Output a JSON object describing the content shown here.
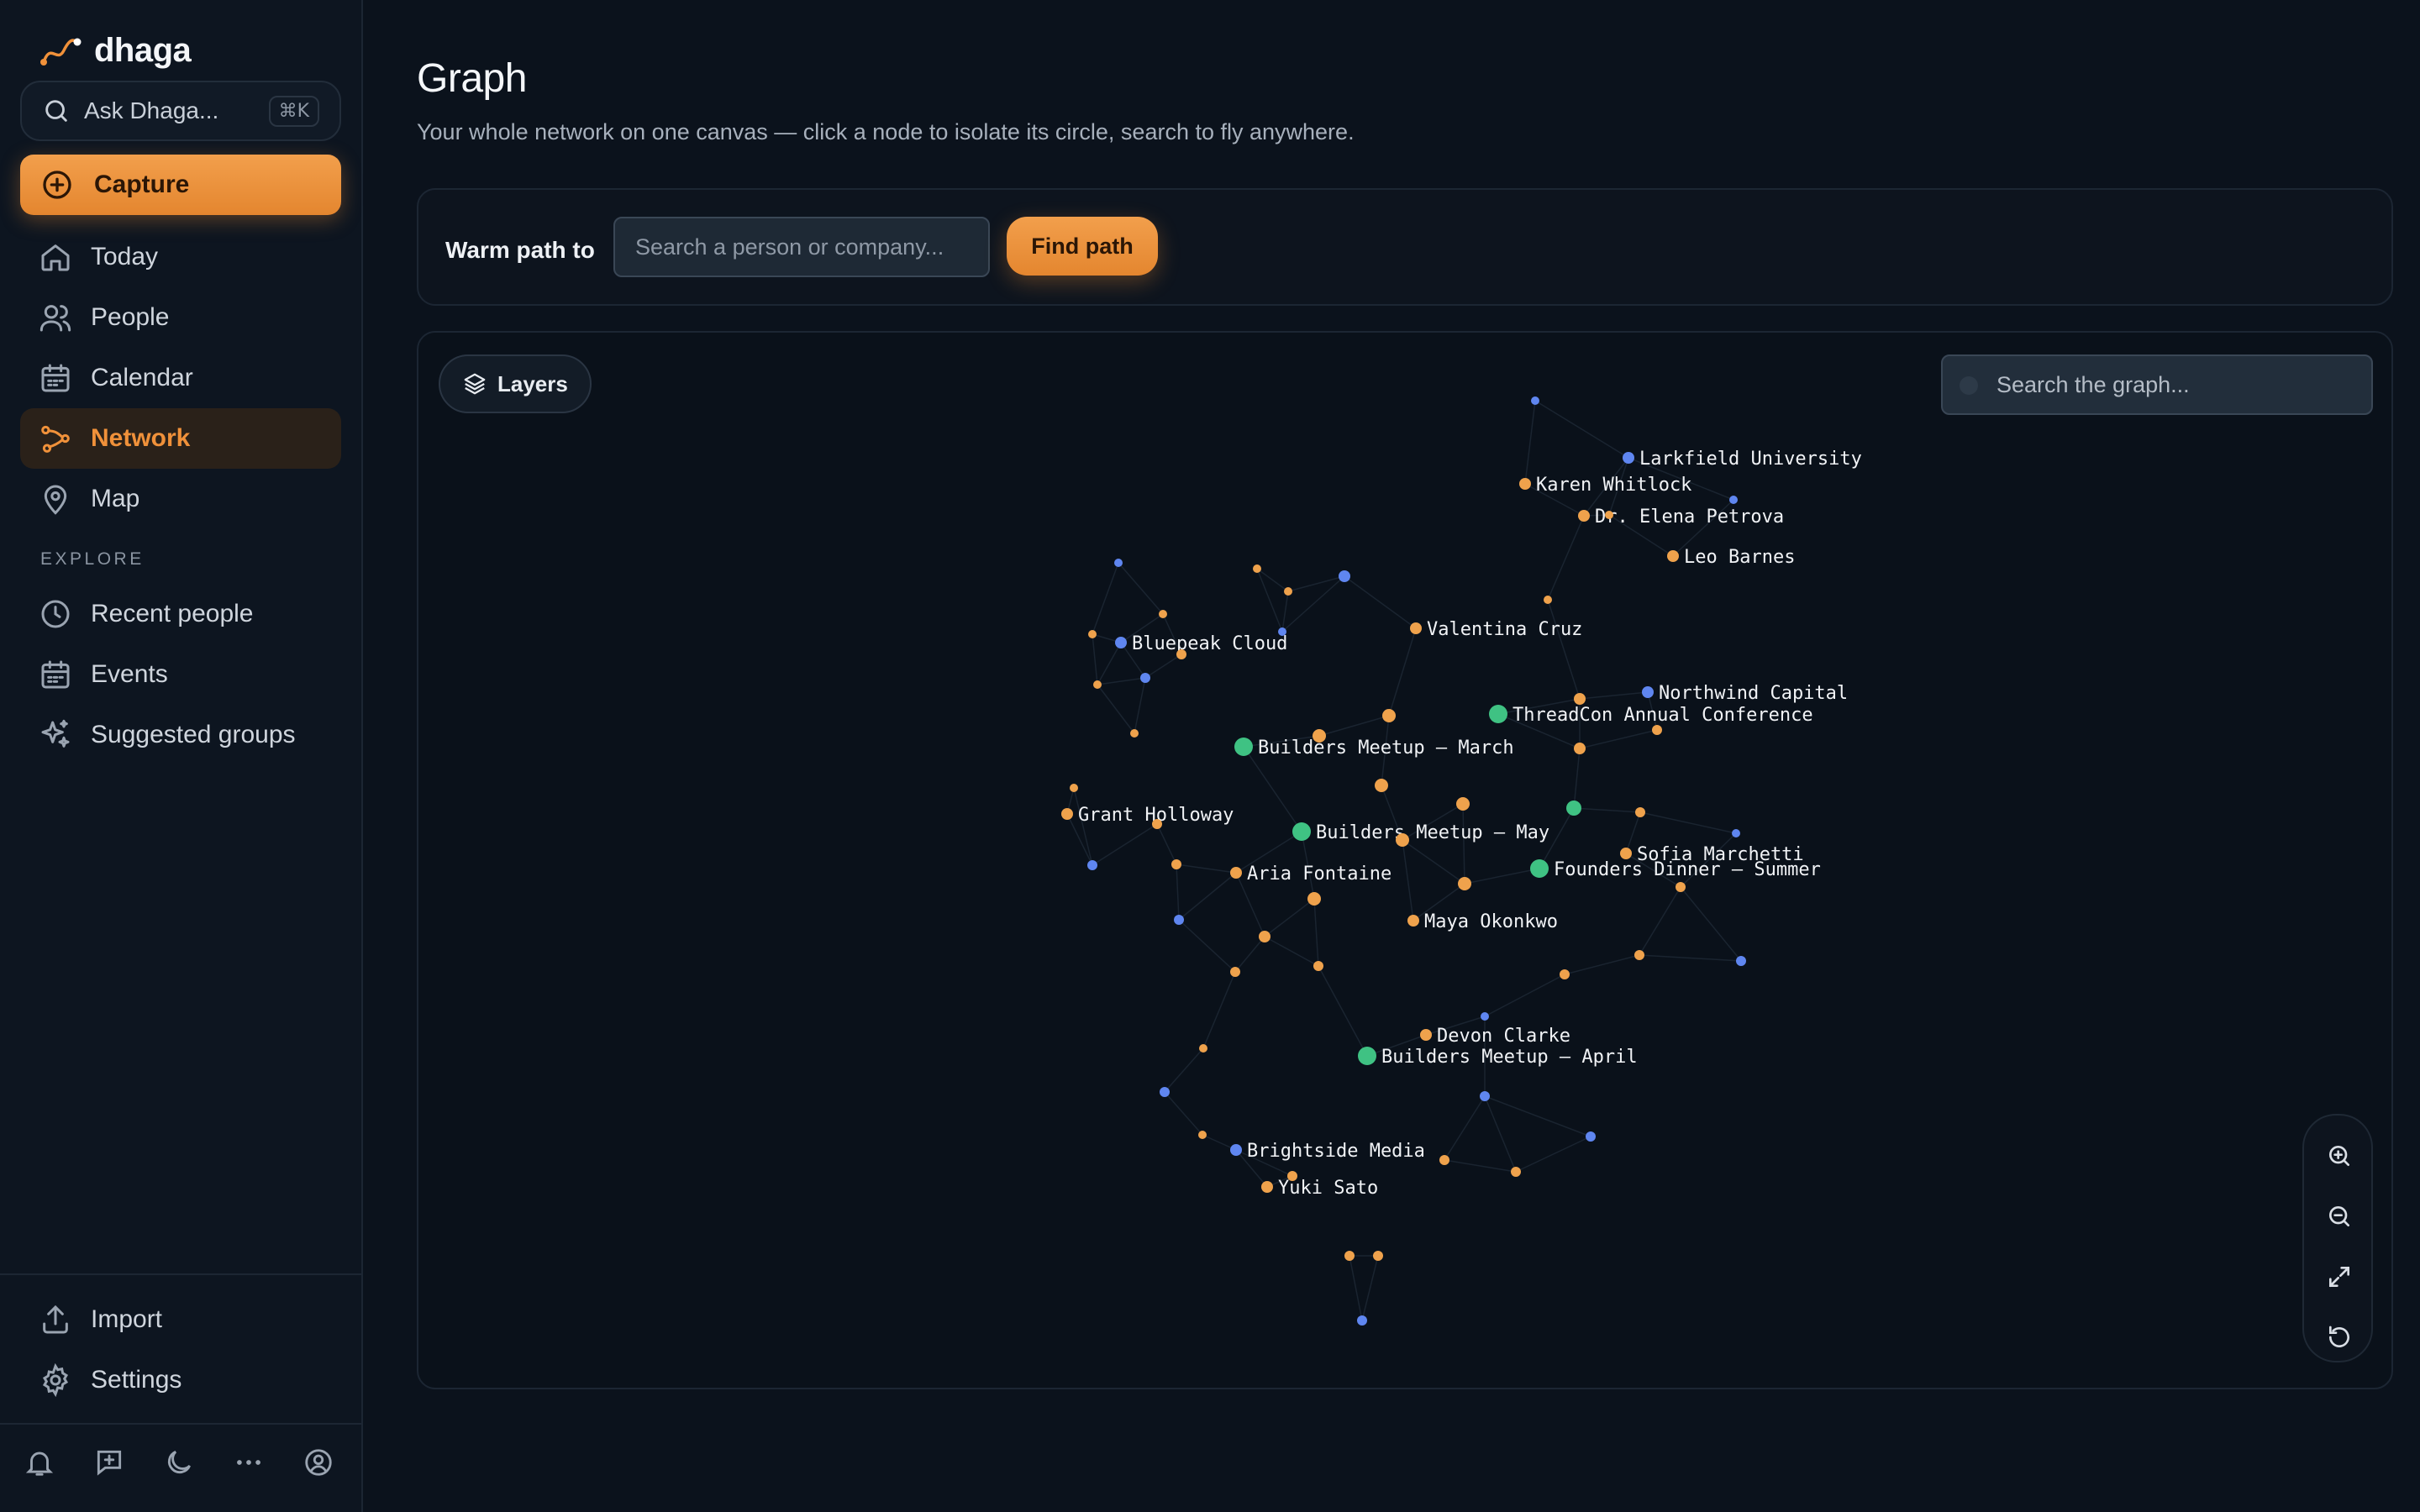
{
  "app": {
    "name": "dhaga"
  },
  "sidebar": {
    "ask_placeholder": "Ask Dhaga...",
    "ask_shortcut": "⌘K",
    "capture_label": "Capture",
    "nav": [
      {
        "label": "Today",
        "icon": "home-icon"
      },
      {
        "label": "People",
        "icon": "users-icon"
      },
      {
        "label": "Calendar",
        "icon": "calendar-icon"
      },
      {
        "label": "Network",
        "icon": "network-icon",
        "active": true
      },
      {
        "label": "Map",
        "icon": "map-pin-icon"
      }
    ],
    "explore_label": "EXPLORE",
    "explore": [
      {
        "label": "Recent people",
        "icon": "clock-icon"
      },
      {
        "label": "Events",
        "icon": "calendar-icon"
      },
      {
        "label": "Suggested groups",
        "icon": "sparkles-icon"
      }
    ],
    "bottom": [
      {
        "label": "Import",
        "icon": "upload-icon"
      },
      {
        "label": "Settings",
        "icon": "gear-icon"
      }
    ],
    "footer_icons": [
      "bell-icon",
      "message-plus-icon",
      "moon-icon",
      "more-icon",
      "user-circle-icon"
    ]
  },
  "page": {
    "title": "Graph",
    "subtitle": "Your whole network on one canvas — click a node to isolate its circle, search to fly anywhere."
  },
  "warm_path": {
    "label": "Warm path to",
    "placeholder": "Search a person or company...",
    "button": "Find path"
  },
  "graph": {
    "layers_label": "Layers",
    "search_placeholder": "Search the graph...",
    "zoom_controls": [
      "zoom-in-icon",
      "zoom-out-icon",
      "fit-view-icon",
      "reset-icon"
    ],
    "colors": {
      "person": "#efa24c",
      "company": "#5f86f0",
      "event": "#3fc283"
    },
    "labeled_nodes": [
      {
        "label": "Larkfield University",
        "kind": "company"
      },
      {
        "label": "Karen Whitlock",
        "kind": "person"
      },
      {
        "label": "Dr. Elena Petrova",
        "kind": "person"
      },
      {
        "label": "Leo Barnes",
        "kind": "person"
      },
      {
        "label": "Valentina Cruz",
        "kind": "person"
      },
      {
        "label": "Bluepeak Cloud",
        "kind": "company"
      },
      {
        "label": "Northwind Capital",
        "kind": "company"
      },
      {
        "label": "ThreadCon Annual Conference",
        "kind": "event"
      },
      {
        "label": "Builders Meetup — March",
        "kind": "event"
      },
      {
        "label": "Grant Holloway",
        "kind": "person"
      },
      {
        "label": "Builders Meetup — May",
        "kind": "event"
      },
      {
        "label": "Sofia Marchetti",
        "kind": "person"
      },
      {
        "label": "Aria Fontaine",
        "kind": "person"
      },
      {
        "label": "Founders Dinner — Summer",
        "kind": "event"
      },
      {
        "label": "Maya Okonkwo",
        "kind": "person"
      },
      {
        "label": "Devon Clarke",
        "kind": "person"
      },
      {
        "label": "Builders Meetup — April",
        "kind": "event"
      },
      {
        "label": "Brightside Media",
        "kind": "company"
      },
      {
        "label": "Yuki Sato",
        "kind": "person"
      }
    ]
  }
}
